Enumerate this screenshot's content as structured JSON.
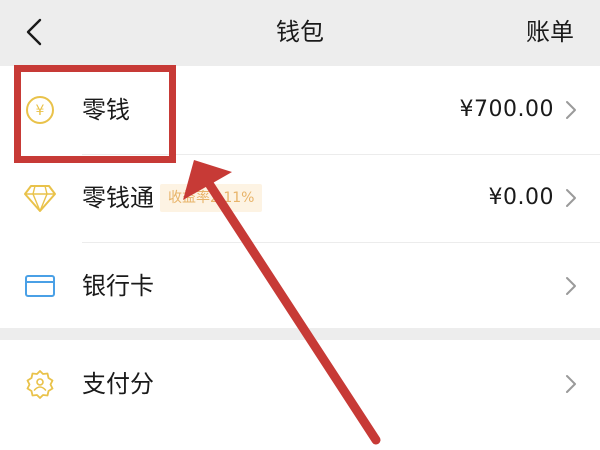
{
  "header": {
    "title": "钱包",
    "bill_label": "账单"
  },
  "rows": [
    {
      "label": "零钱",
      "value": "¥700.00",
      "icon": "yuan-circle-icon"
    },
    {
      "label": "零钱通",
      "badge": "收益率2.11%",
      "value": "¥0.00",
      "icon": "diamond-icon"
    },
    {
      "label": "银行卡",
      "icon": "bank-card-icon"
    },
    {
      "label": "支付分",
      "icon": "payscore-badge-icon"
    }
  ],
  "colors": {
    "accent_yellow": "#e9c24a",
    "annotation_red": "#c73a36",
    "card_blue": "#4aa0e6",
    "badge_bg": "#fdf3e3",
    "badge_text": "#e8b46a"
  }
}
